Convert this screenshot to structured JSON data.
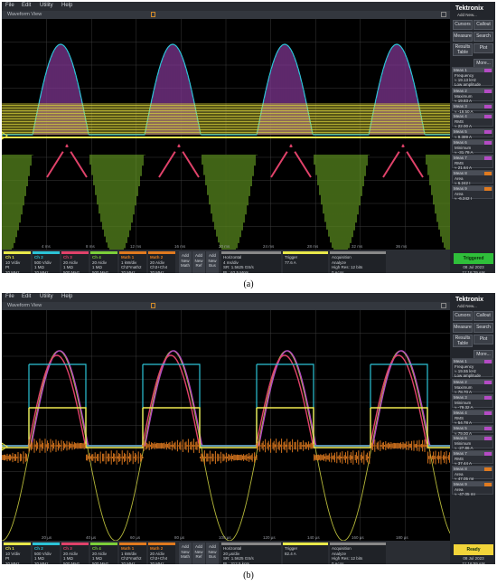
{
  "scopes": [
    {
      "menu": [
        "File",
        "Edit",
        "Utility",
        "Help"
      ],
      "window_title": "Waveform View",
      "brand": "Tektronix",
      "brand_sub": "Add New...",
      "side_buttons": [
        "Cursors",
        "Callout",
        "Measure",
        "Search",
        "Results Table",
        "Plot",
        "More..."
      ],
      "measurements": [
        {
          "title": "Meas 1",
          "lines": [
            "Frequency",
            "≈ 19.13 kHz",
            "Low amplitude"
          ],
          "color": "#b44bc4"
        },
        {
          "title": "Meas 2",
          "lines": [
            "Maximum",
            "≈ 19.83 A"
          ],
          "color": "#b44bc4"
        },
        {
          "title": "Meas 3",
          "lines": [
            "≈ -19.50 A"
          ],
          "color": "#b44bc4"
        },
        {
          "title": "Meas 4",
          "lines": [
            "RMS",
            "≈ 22.00 A"
          ],
          "color": "#b44bc4"
        },
        {
          "title": "Meas 5",
          "lines": [
            "≈ 9.389 A"
          ],
          "color": "#b44bc4"
        },
        {
          "title": "Meas 6",
          "lines": [
            "Minimum",
            "≈ -31.78 A"
          ],
          "color": "#b44bc4"
        },
        {
          "title": "Meas 7",
          "lines": [
            "RMS",
            "≈ 21.64 A"
          ],
          "color": "#b44bc4"
        },
        {
          "title": "Meas 8",
          "lines": [
            "Area",
            "≈ 6.242 I"
          ],
          "color": "#e07a1f"
        },
        {
          "title": "Meas 9",
          "lines": [
            "Area",
            "≈ -6.242 I"
          ],
          "color": "#e07a1f"
        }
      ],
      "x_ticks": [
        "4 ms",
        "8 ms",
        "12 ms",
        "16 ms",
        "20 ms",
        "24 ms",
        "28 ms",
        "32 ms",
        "36 ms"
      ],
      "channels": [
        {
          "name": "Ch 1",
          "lines": [
            "10 V/div",
            "Pt",
            "20 MHz"
          ],
          "color": "#e8e84a"
        },
        {
          "name": "Ch 2",
          "lines": [
            "500 V/div",
            "1 MΩ",
            "20 MHz"
          ],
          "color": "#2cc3d6"
        },
        {
          "name": "Ch 3",
          "lines": [
            "20 A/div",
            "1 MΩ",
            "500 MHz"
          ],
          "color": "#e0426a"
        },
        {
          "name": "Ch 4",
          "lines": [
            "20 A/div",
            "1 MΩ",
            "500 MHz"
          ],
          "color": "#7ccf3a"
        },
        {
          "name": "Math 1",
          "lines": [
            "1 kW/div",
            "Ch2*math2",
            "20 MHz"
          ],
          "color": "#e07a1f"
        },
        {
          "name": "Math 2",
          "lines": [
            "20 A/div",
            "Ch3+Ch4",
            "20 MHz"
          ],
          "color": "#e07a1f"
        }
      ],
      "add_buttons": [
        "Add New Math",
        "Add New Ref",
        "Add New Bus"
      ],
      "horizontal": {
        "title": "Horizontal",
        "lines": [
          "4 ms/div",
          "SR: 1.5625 GS/s",
          "RL: 62.5 Mpts"
        ]
      },
      "trigger": {
        "title": "Trigger",
        "lines": [
          "77.6 A"
        ]
      },
      "acquisition": {
        "title": "Acquisition",
        "lines": [
          "Analyze",
          "High Res: 12 bits",
          "0 Acqs"
        ]
      },
      "status_label": "Triggered",
      "status_color": "#2fbf3a",
      "date": "08 Jul 2023",
      "time": "11:16:29 AM",
      "caption": "(a)"
    },
    {
      "menu": [
        "File",
        "Edit",
        "Utility",
        "Help"
      ],
      "window_title": "Waveform View",
      "brand": "Tektronix",
      "brand_sub": "Add New...",
      "side_buttons": [
        "Cursors",
        "Callout",
        "Measure",
        "Search",
        "Results Table",
        "Plot",
        "More..."
      ],
      "measurements": [
        {
          "title": "Meas 1",
          "lines": [
            "Frequency",
            "≈ 19.55 kHz",
            "Low amplitude"
          ],
          "color": "#b44bc4"
        },
        {
          "title": "Meas 2",
          "lines": [
            "Maximum",
            "≈ 78.70 A"
          ],
          "color": "#b44bc4"
        },
        {
          "title": "Meas 3",
          "lines": [
            "Minimum",
            "≈ -79.32 A"
          ],
          "color": "#b44bc4"
        },
        {
          "title": "Meas 4",
          "lines": [
            "RMS",
            "≈ 54.78 A"
          ],
          "color": "#b44bc4"
        },
        {
          "title": "Meas 5",
          "lines": [
            "≈ 79.00 A"
          ],
          "color": "#b44bc4"
        },
        {
          "title": "Meas 6",
          "lines": [
            "Minimum",
            "≈ -27.86 A"
          ],
          "color": "#b44bc4"
        },
        {
          "title": "Meas 7",
          "lines": [
            "RMS",
            "≈ 37.44 A"
          ],
          "color": "#b44bc4"
        },
        {
          "title": "Meas 8",
          "lines": [
            "Area",
            "≈ 47.05 mI"
          ],
          "color": "#e07a1f"
        },
        {
          "title": "Meas 9",
          "lines": [
            "Area",
            "≈ -47.05 mI"
          ],
          "color": "#e07a1f"
        }
      ],
      "x_ticks": [
        "20 µs",
        "40 µs",
        "60 µs",
        "80 µs",
        "100 µs",
        "120 µs",
        "140 µs",
        "160 µs",
        "180 µs"
      ],
      "channels": [
        {
          "name": "Ch 1",
          "lines": [
            "10 V/div",
            "Pt",
            "20 MHz"
          ],
          "color": "#e8e84a"
        },
        {
          "name": "Ch 2",
          "lines": [
            "500 V/div",
            "1 MΩ",
            "20 MHz"
          ],
          "color": "#2cc3d6"
        },
        {
          "name": "Ch 3",
          "lines": [
            "20 A/div",
            "1 MΩ",
            "500 MHz"
          ],
          "color": "#e0426a"
        },
        {
          "name": "Ch 4",
          "lines": [
            "20 A/div",
            "1 MΩ",
            "500 MHz"
          ],
          "color": "#7ccf3a"
        },
        {
          "name": "Math 1",
          "lines": [
            "1 kW/div",
            "Ch2*math2",
            "20 MHz"
          ],
          "color": "#e07a1f"
        },
        {
          "name": "Math 2",
          "lines": [
            "20 A/div",
            "Ch3+Ch4",
            "20 MHz"
          ],
          "color": "#e07a1f"
        }
      ],
      "add_buttons": [
        "Add New Math",
        "Add New Ref",
        "Add New Bus"
      ],
      "horizontal": {
        "title": "Horizontal",
        "lines": [
          "20 µs/div",
          "SR: 1.5625 GS/s",
          "RL: 312.5 kpts"
        ]
      },
      "trigger": {
        "title": "Trigger",
        "lines": [
          "82.4 A"
        ]
      },
      "acquisition": {
        "title": "Acquisition",
        "lines": [
          "Analyze",
          "High Res: 12 bits",
          "0 Acqs"
        ]
      },
      "status_label": "Ready",
      "status_color": "#f2d43a",
      "date": "08 Jul 2023",
      "time": "11:16:59 AM",
      "caption": "(b)"
    }
  ]
}
